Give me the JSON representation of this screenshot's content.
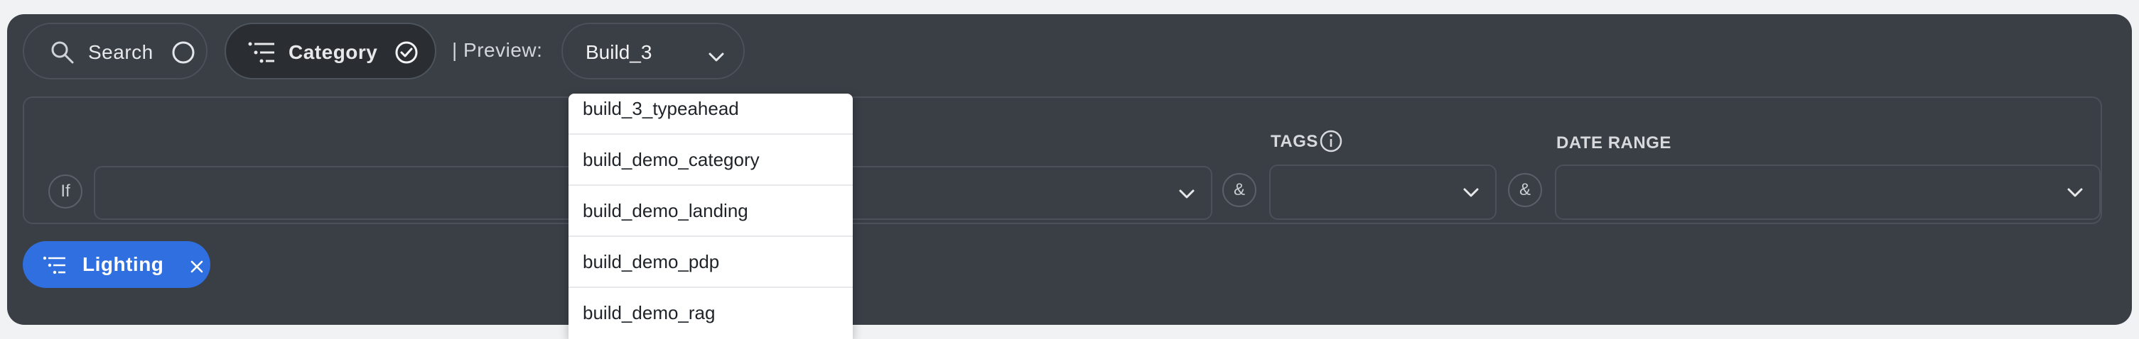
{
  "toolbar": {
    "search_label": "Search",
    "category_label": "Category",
    "preview_label": "| Preview:",
    "preview_value": "Build_3"
  },
  "rule": {
    "if_label": "If",
    "and_label_1": "&",
    "and_label_2": "&",
    "tags_label": "TAGS",
    "date_range_label": "DATE RANGE"
  },
  "chips": [
    {
      "label": "Lighting"
    }
  ],
  "dropdown": {
    "options": [
      "build_3_typeahead",
      "build_demo_category",
      "build_demo_landing",
      "build_demo_pdp",
      "build_demo_rag"
    ]
  },
  "colors": {
    "panel_bg": "#3a3f46",
    "chip_bg": "#2f6fe0",
    "dropdown_bg": "#ffffff"
  }
}
